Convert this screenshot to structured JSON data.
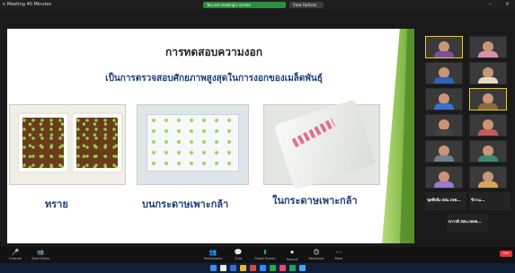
{
  "window": {
    "title": "n Meeting 40 Minutes",
    "share_status": "You are viewing's screen",
    "view_options": "View Options"
  },
  "slide": {
    "title": "การทดสอบความงอก",
    "subtitle": "เป็นการตรวจสอบศักยภาพสูงสุดในการงอกของเมล็ดพันธุ์",
    "captions": [
      "ทราย",
      "บนกระดาษเพาะกล้า",
      "ในกระดาษเพาะกล้า"
    ]
  },
  "gallery": {
    "tiles": [
      {
        "name": ""
      },
      {
        "name": ""
      },
      {
        "name": ""
      },
      {
        "name": ""
      },
      {
        "name": ""
      },
      {
        "name": ""
      },
      {
        "name": ""
      },
      {
        "name": ""
      },
      {
        "name": ""
      },
      {
        "name": ""
      },
      {
        "name": ""
      },
      {
        "name": ""
      }
    ],
    "name_tiles": [
      {
        "name": "ชุดที่หนึ่ง สสม.กจพ...",
        "sub": ""
      },
      {
        "name": "ชีวาณ...",
        "sub": ""
      },
      {
        "name": "ทวารดี สสม.กพงพ...",
        "sub": ""
      }
    ]
  },
  "toolbar": {
    "items": [
      {
        "icon": "🎤",
        "label": "Unmute"
      },
      {
        "icon": "📹",
        "label": "Start Video"
      },
      {
        "icon": "👥",
        "label": "Participants"
      },
      {
        "icon": "💬",
        "label": "Chat"
      },
      {
        "icon": "⬆",
        "label": "Share Screen"
      },
      {
        "icon": "⏺",
        "label": "Record"
      },
      {
        "icon": "😊",
        "label": "Reactions"
      },
      {
        "icon": "⋯",
        "label": "More"
      }
    ],
    "end": "End"
  },
  "taskbar": {
    "clock": ""
  },
  "colors": {
    "accent_green": "#2fce4f",
    "end_red": "#e5323c",
    "caption_blue": "#1f3d7a"
  }
}
